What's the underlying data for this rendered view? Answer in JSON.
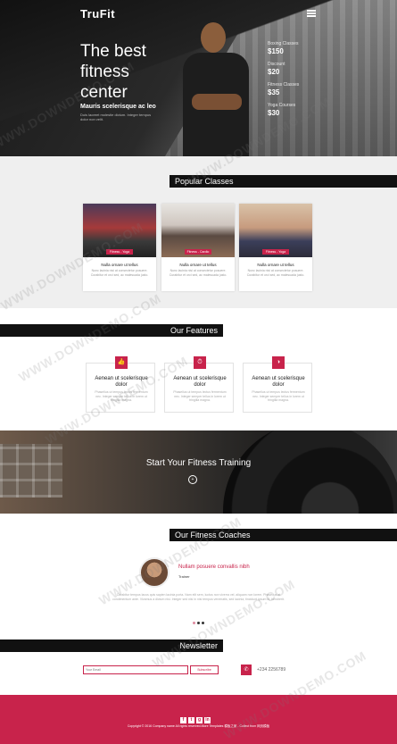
{
  "header": {
    "logo": "TruFit"
  },
  "hero": {
    "title": "The best fitness center",
    "subtitle": "Mauris scelerisque ac leo",
    "description": "Duis laoreet molestie dictum. Integer tempus dolor non velit.",
    "prices": [
      {
        "name": "Boxing Classes",
        "value": "$150"
      },
      {
        "name": "Discount",
        "value": "$20"
      },
      {
        "name": "Fitness Classes",
        "value": "$35"
      },
      {
        "name": "Yoga Courses",
        "value": "$30"
      }
    ]
  },
  "classes": {
    "heading": "Popular Classes",
    "items": [
      {
        "tag": "Fitness - Yoga",
        "title": "Nulla ornare ut tellus",
        "text": "Nunc lacinia nisi at consectetur posuere. Curabitur et orci sed, ac malesuada justo."
      },
      {
        "tag": "Fitness - Cardio",
        "title": "Nulla ornare ut tellus",
        "text": "Nunc lacinia nisi at consectetur posuere. Curabitur et orci sed, ac malesuada justo."
      },
      {
        "tag": "Fitness - Yoga",
        "title": "Nulla ornare ut tellus",
        "text": "Nunc lacinia nisi at consectetur posuere. Curabitur et orci sed, ac malesuada justo."
      }
    ]
  },
  "features": {
    "heading": "Our Features",
    "items": [
      {
        "icon": "👍",
        "title": "Aenean ut scelerisque dolor",
        "text": "Phasellus ut tempus lectus fermentum nec. Integer semper tellus in lorem ut fringilla magna."
      },
      {
        "icon": "⏱",
        "title": "Aenean ut scelerisque dolor",
        "text": "Phasellus ut tempus lectus fermentum nec. Integer semper tellus in lorem ut fringilla magna."
      },
      {
        "icon": "◑",
        "title": "Aenean ut scelerisque dolor",
        "text": "Phasellus ut tempus lectus fermentum nec. Integer semper tellus in lorem ut fringilla magna."
      }
    ]
  },
  "banner": {
    "title": "Start Your Fitness Training",
    "play_icon": "+"
  },
  "coaches": {
    "heading": "Our Fitness Coaches",
    "name": "Nullam posuere convallis nibh",
    "role": "Trainer",
    "text": "Curabitur tempus lacus quis sapien lacinia porta. Nam elit sem, luctus non viverra vel, aliquam non lorem. Phasellus at condimentum ante. Vivamus a dictum nisi. Integer sed nisi in nisi tempus venenatis, sed lacinia, tincidunt ipsum id, hendrerit."
  },
  "newsletter": {
    "heading": "Newsletter",
    "input_placeholder": "Your Email",
    "button_label": "Subscribe",
    "phone": "+234 2256789"
  },
  "footer": {
    "socials": [
      "f",
      "t",
      "g",
      "in"
    ],
    "copyright": "Copyright © 2016 Company name All rights reserved.More Templates 模板之家 - Collect from 网页模板"
  },
  "watermark": "WWW.DOWNDEMO.COM",
  "colors": {
    "accent": "#c8234b",
    "dark": "#111111"
  }
}
